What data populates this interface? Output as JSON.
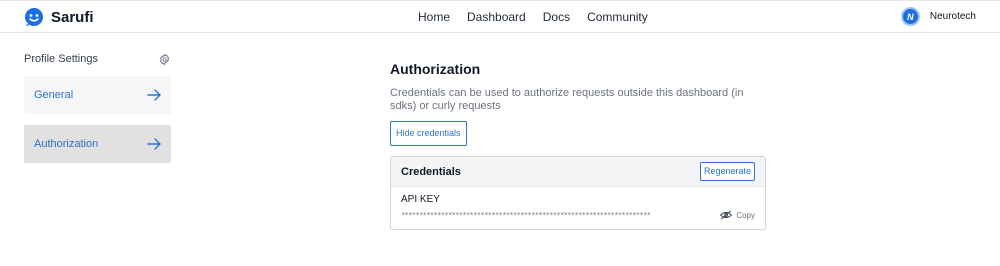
{
  "brand": {
    "name": "Sarufi"
  },
  "nav": {
    "items": [
      "Home",
      "Dashboard",
      "Docs",
      "Community"
    ]
  },
  "user": {
    "avatar_initials": "N",
    "name": "Neurotech"
  },
  "sidebar": {
    "title": "Profile Settings",
    "items": [
      {
        "label": "General",
        "active": false
      },
      {
        "label": "Authorization",
        "active": true
      }
    ]
  },
  "main": {
    "title": "Authorization",
    "description": "Credentials can be used to authorize requests outside this dashboard (in sdks) or curly requests",
    "hide_button": "Hide credentials"
  },
  "credentials": {
    "title": "Credentials",
    "regenerate_button": "Regenerate",
    "api_key_label": "API KEY",
    "api_key_value": "*********************************************************************",
    "copy_label": "Copy"
  },
  "colors": {
    "accent": "#2b72c9",
    "avatar": "#1d6fe0",
    "active_bg": "#e1e1e1"
  },
  "icons": {
    "logo": "smiley-bot-icon",
    "settings": "gear-icon",
    "arrow": "arrow-right-icon",
    "visibility": "eye-off-icon"
  }
}
